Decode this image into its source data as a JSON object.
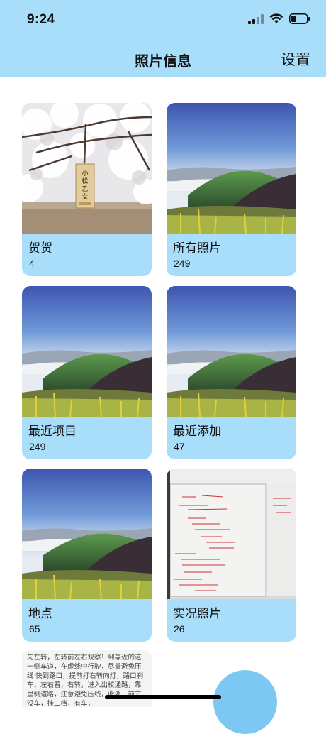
{
  "status": {
    "time": "9:24"
  },
  "nav": {
    "title": "照片信息",
    "settings": "设置"
  },
  "albums": [
    {
      "name": "贺贺",
      "count": "4",
      "thumb": "cherry-blossom-tag",
      "tag_text": "小松乙女"
    },
    {
      "name": "所有照片",
      "count": "249",
      "thumb": "mountain-landscape"
    },
    {
      "name": "最近项目",
      "count": "249",
      "thumb": "mountain-landscape"
    },
    {
      "name": "最近添加",
      "count": "47",
      "thumb": "mountain-landscape"
    },
    {
      "name": "地点",
      "count": "65",
      "thumb": "mountain-landscape"
    },
    {
      "name": "实况照片",
      "count": "26",
      "thumb": "whiteboard-notes"
    }
  ],
  "partial_card": {
    "text": "先左转，左转前左右观察！到靠近的这一侧车道，在虚线中行驶，尽量避免压线 快到路口，提前打右转向灯，路口刹车，左右看，右转，进入出校通路，靠里侧道路，注意避免压线，此处，前方没车，挂二档，有车，"
  },
  "colors": {
    "accent": "#a9defa",
    "fab": "#7cc8f2"
  }
}
